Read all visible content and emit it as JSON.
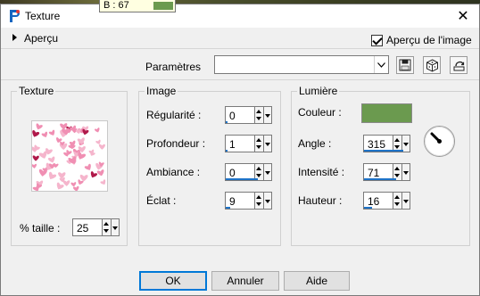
{
  "tooltip": {
    "text": "B : 67",
    "swatch_color": "#6b9a4f"
  },
  "window": {
    "title": "Texture",
    "app_icon": "paintshop-icon",
    "close_icon": "close-icon"
  },
  "top": {
    "apercu_label": "Aperçu",
    "preview_checkbox": {
      "label": "Aperçu de l'image",
      "checked": true
    }
  },
  "params": {
    "label": "Paramètres",
    "value": "",
    "tools": [
      "save-preset-icon",
      "random-dice-icon",
      "reset-icon"
    ]
  },
  "texture": {
    "title": "Texture",
    "size_label": "% taille :",
    "size_value": "25"
  },
  "image": {
    "title": "Image",
    "fields": [
      {
        "label": "Régularité :",
        "value": "0",
        "fill": 0
      },
      {
        "label": "Profondeur :",
        "value": "1",
        "fill": 0.02
      },
      {
        "label": "Ambiance :",
        "value": "0",
        "fill": 0.72
      },
      {
        "label": "Éclat :",
        "value": "9",
        "fill": 0.09
      }
    ]
  },
  "lumiere": {
    "title": "Lumière",
    "color_label": "Couleur :",
    "color": "#6b9a4f",
    "fields": [
      {
        "label": "Angle :",
        "value": "315",
        "fill": 0.875
      },
      {
        "label": "Intensité :",
        "value": "71",
        "fill": 0.71
      },
      {
        "label": "Hauteur :",
        "value": "16",
        "fill": 0.18
      }
    ]
  },
  "buttons": {
    "ok": "OK",
    "cancel": "Annuler",
    "help": "Aide"
  }
}
